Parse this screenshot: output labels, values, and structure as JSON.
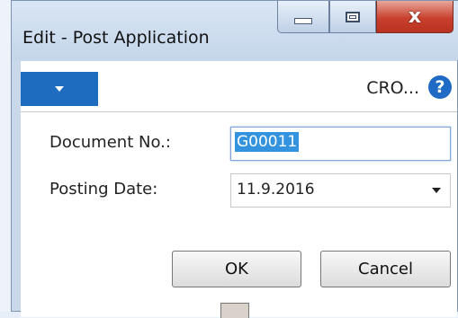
{
  "window": {
    "title": "Edit - Post Application",
    "close_glyph": "x"
  },
  "action_bar": {
    "company": "CRO...",
    "help_glyph": "?"
  },
  "form": {
    "document_no": {
      "label": "Document No.:",
      "value": "G00011"
    },
    "posting_date": {
      "label": "Posting Date:",
      "value": "11.9.2016"
    }
  },
  "buttons": {
    "ok": "OK",
    "cancel": "Cancel"
  },
  "colors": {
    "accent": "#1d6cc0",
    "selection": "#3393df",
    "close": "#c9412e"
  },
  "icons": [
    "chevron-down-icon",
    "help-icon",
    "minimize-icon",
    "maximize-icon",
    "close-icon"
  ]
}
